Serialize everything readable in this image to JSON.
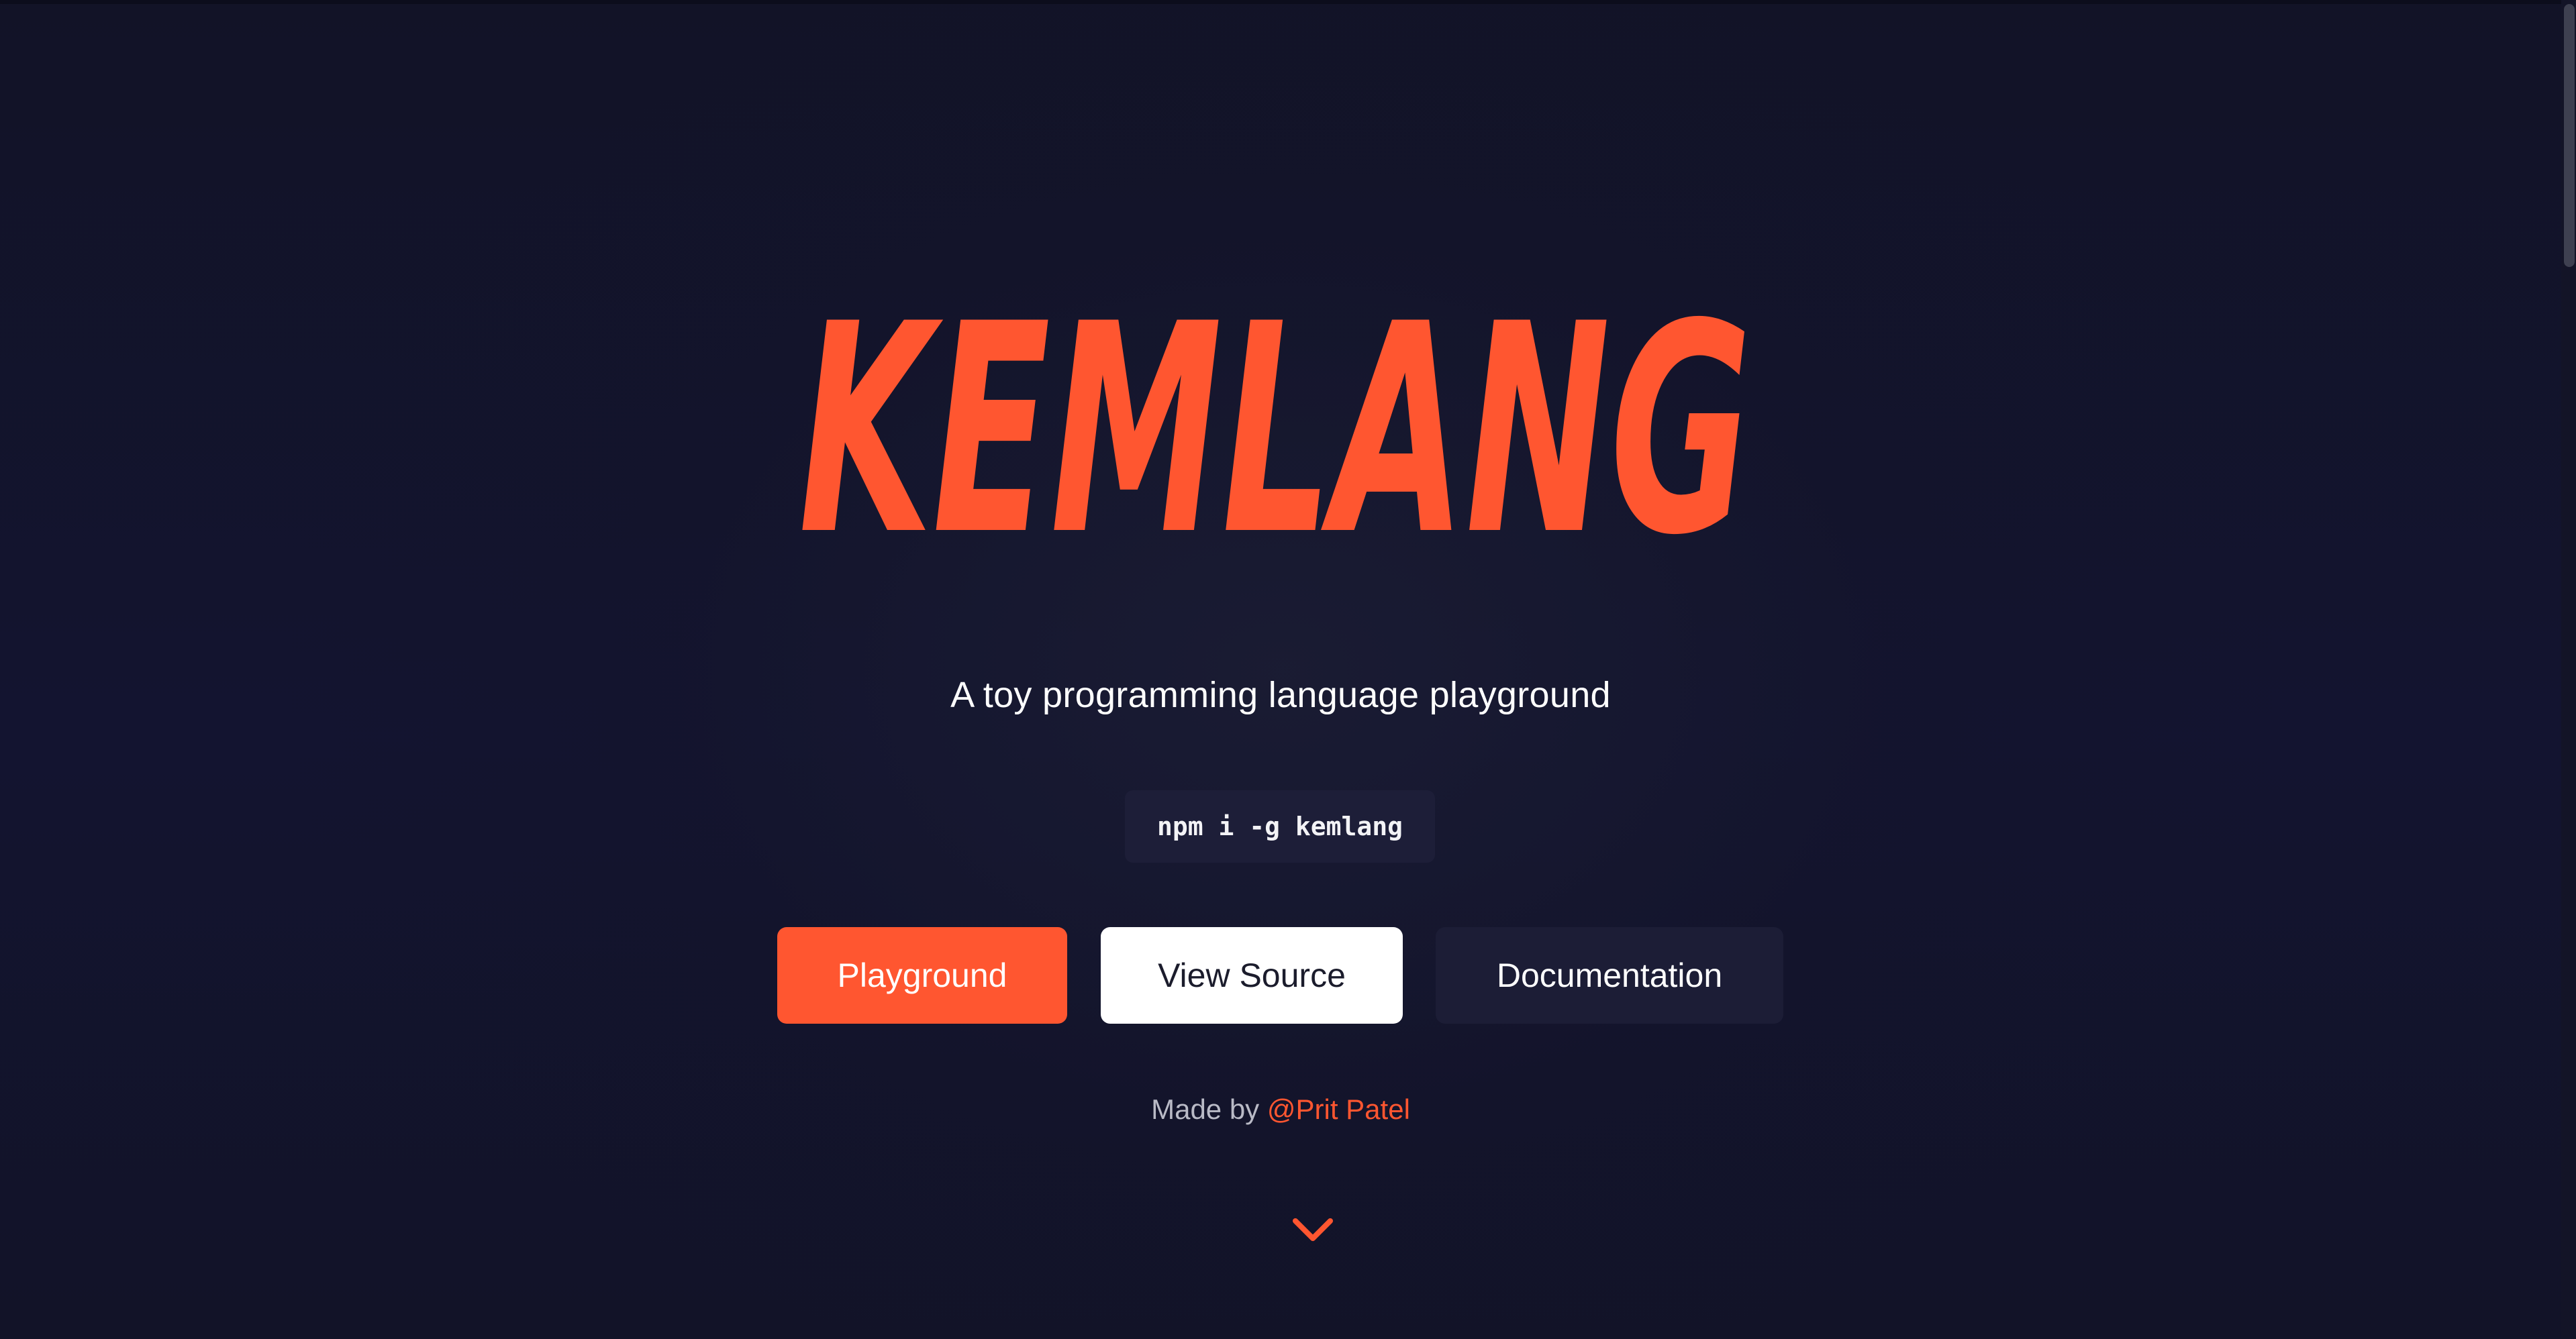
{
  "brand": {
    "logo_text": "KEMLANG",
    "accent_color": "#ff5630"
  },
  "hero": {
    "tagline": "A toy programming language playground",
    "install_command": "npm i -g kemlang"
  },
  "buttons": {
    "playground": "Playground",
    "view_source": "View Source",
    "documentation": "Documentation"
  },
  "footer": {
    "made_by": "Made by",
    "author": "@Prit Patel"
  },
  "icons": {
    "scroll_down": "chevron-down-icon"
  },
  "colors": {
    "background": "#12132a",
    "accent": "#ff5630",
    "install_bg": "#1d1e38",
    "docs_button_bg": "#1c1d36",
    "source_button_bg": "#ffffff"
  }
}
